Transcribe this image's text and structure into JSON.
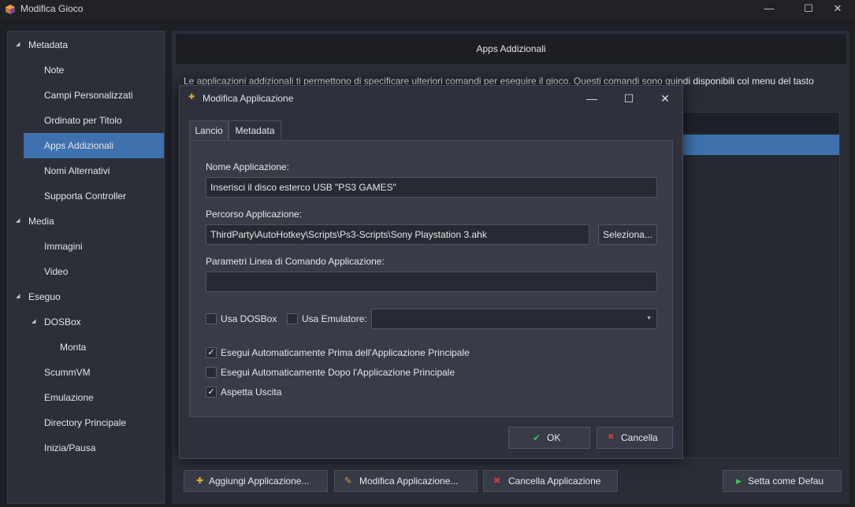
{
  "window": {
    "title": "Modifica Gioco",
    "minimize_glyph": "—",
    "maximize_glyph": "☐",
    "close_glyph": "✕"
  },
  "tree": {
    "items": [
      {
        "label": "Metadata",
        "level": 0,
        "expandable": true
      },
      {
        "label": "Note",
        "level": 1
      },
      {
        "label": "Campi Personalizzati",
        "level": 1
      },
      {
        "label": "Ordinato per Titolo",
        "level": 1
      },
      {
        "label": "Apps Addizionali",
        "level": 1,
        "selected": true
      },
      {
        "label": "Nomi Alternativi",
        "level": 1
      },
      {
        "label": "Supporta Controller",
        "level": 1
      },
      {
        "label": "Media",
        "level": 0,
        "expandable": true
      },
      {
        "label": "Immagini",
        "level": 1
      },
      {
        "label": "Video",
        "level": 1
      },
      {
        "label": "Eseguo",
        "level": 0,
        "expandable": true
      },
      {
        "label": "DOSBox",
        "level": 1,
        "expandable": true
      },
      {
        "label": "Monta",
        "level": 2
      },
      {
        "label": "ScummVM",
        "level": 1
      },
      {
        "label": "Emulazione",
        "level": 1
      },
      {
        "label": "Directory Principale",
        "level": 1
      },
      {
        "label": "Inizia/Pausa",
        "level": 1
      }
    ]
  },
  "main": {
    "header": "Apps Addizionali",
    "description": "Le applicazioni addizionali ti permettono di specificare ulteriori comandi per eseguire il gioco. Questi comandi sono quindi disponibili col menu del tasto",
    "buttons": {
      "add": "Aggiungi Applicazione...",
      "edit": "Modifica Applicazione...",
      "delete": "Cancella Applicazione",
      "set_default": "Setta come Defau"
    }
  },
  "dialog": {
    "title": "Modifica Applicazione",
    "tabs": [
      "Lancio",
      "Metadata"
    ],
    "active_tab": "Lancio",
    "name_label": "Nome Applicazione:",
    "name_value": "Inserisci il disco esterco USB \"PS3 GAMES\"",
    "path_label": "Percorso Applicazione:",
    "path_value": "ThirdParty\\AutoHotkey\\Scripts\\Ps3-Scripts\\Sony Playstation 3.ahk",
    "browse_label": "Seleziona...",
    "params_label": "Parametri Linea di Comando Applicazione:",
    "params_value": "",
    "use_dosbox_label": "Usa DOSBox",
    "use_dosbox_checked": false,
    "use_emulator_label": "Usa Emulatore:",
    "use_emulator_checked": false,
    "emulator_value": "",
    "run_before_label": "Esegui Automaticamente Prima dell'Applicazione Principale",
    "run_before_checked": true,
    "run_after_label": "Esegui Automaticamente Dopo l'Applicazione Principale",
    "run_after_checked": false,
    "wait_exit_label": "Aspetta Uscita",
    "wait_exit_checked": true,
    "ok_label": "OK",
    "cancel_label": "Cancella"
  },
  "colors": {
    "selection": "#3e71ad",
    "ok_check": "#3cc24a",
    "cancel_x": "#d23a3a",
    "add_icon": "#e0b030",
    "edit_icon": "#e0a030",
    "play_icon": "#3cc24a"
  }
}
